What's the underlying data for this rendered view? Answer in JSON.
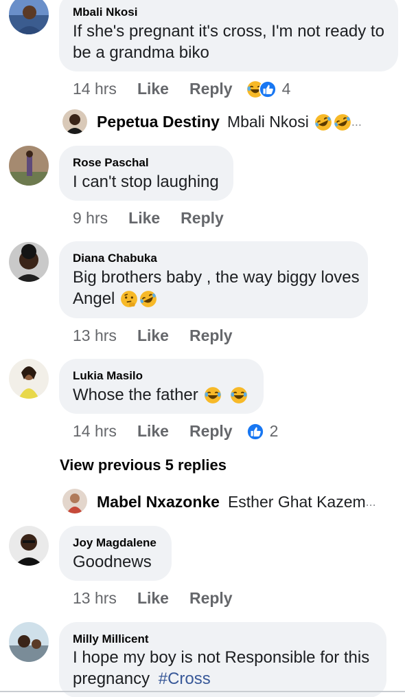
{
  "colors": {
    "bubble_bg": "#f0f2f5",
    "meta_text": "#65676b",
    "hashtag": "#385898",
    "like_badge_blue": "#1877f2",
    "haha_yellow": "#f7b928"
  },
  "comments": [
    {
      "author": "Mbali Nkosi",
      "text_line1": "If she's pregnant it's cross, I'm not ready to",
      "text_line2": "be a grandma biko",
      "time": "14 hrs",
      "like_label": "Like",
      "reply_label": "Reply",
      "reaction_icons": [
        "haha-icon",
        "like-icon"
      ],
      "reaction_count": "4"
    },
    {
      "author": "Rose Paschal",
      "text_line1": "I can't stop laughing",
      "time": "9 hrs",
      "like_label": "Like",
      "reply_label": "Reply"
    },
    {
      "author": "Diana Chabuka",
      "text_line1": "Big brothers baby , the way biggy loves",
      "text_line2": "Angel",
      "text_emojis": [
        "thinking-icon",
        "rofl-icon"
      ],
      "time": "13 hrs",
      "like_label": "Like",
      "reply_label": "Reply"
    },
    {
      "author": "Lukia Masilo",
      "text_line1": "Whose the father",
      "text_emojis": [
        "tears-of-joy-icon",
        "tears-of-joy-icon"
      ],
      "time": "14 hrs",
      "like_label": "Like",
      "reply_label": "Reply",
      "reaction_icons": [
        "like-icon"
      ],
      "reaction_count": "2"
    },
    {
      "author": "Joy Magdalene",
      "text_line1": "Goodnews",
      "time": "13 hrs",
      "like_label": "Like",
      "reply_label": "Reply"
    },
    {
      "author": "Milly Millicent",
      "text_line1": "I hope my boy is not Responsible  for this",
      "text_line2": "pregnancy",
      "hashtag": "#Cross"
    }
  ],
  "reply_previews": [
    {
      "author": "Pepetua Destiny",
      "text": "Mbali Nkosi",
      "emojis": [
        "rofl-icon",
        "rofl-icon"
      ],
      "ellipsis": "..."
    },
    {
      "author": "Mabel Nxazonke",
      "text": "Esther Ghat Kazem",
      "ellipsis": "..."
    }
  ],
  "view_previous": "View previous 5 replies"
}
